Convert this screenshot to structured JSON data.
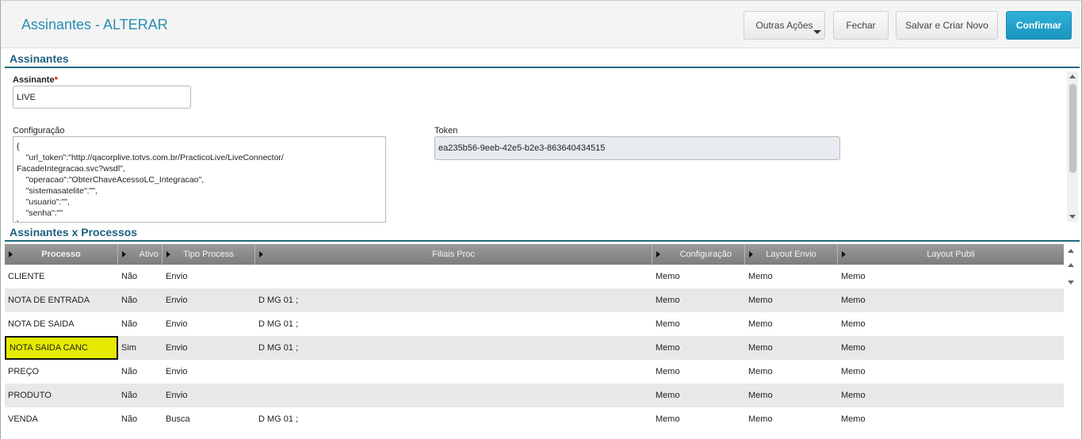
{
  "header": {
    "title": "Assinantes - ALTERAR",
    "buttons": {
      "outras": "Outras Ações",
      "fechar": "Fechar",
      "salvar": "Salvar e Criar Novo",
      "confirmar": "Confirmar"
    }
  },
  "form": {
    "section_title": "Assinantes",
    "assinante_label": "Assinante",
    "assinante_required": "*",
    "assinante_value": "LIVE",
    "config_label": "Configuração",
    "config_value": "{\n    \"url_token\":\"http://qacorplive.totvs.com.br/PracticoLive/LiveConnector/\nFacadeIntegracao.svc?wsdl\",\n    \"operacao\":\"ObterChaveAcessoLC_Integracao\",\n    \"sistemasatelite\":\"\",\n    \"usuario\":\"\",\n    \"senha\":\"\"\n}",
    "token_label": "Token",
    "token_value": "ea235b56-9eeb-42e5-b2e3-863640434515"
  },
  "processos": {
    "section_title": "Assinantes x Processos",
    "columns": [
      "Processo",
      "Ativo",
      "Tipo Process",
      "Filiais Proc",
      "Configuração",
      "Layout Envio",
      "Layout Publi"
    ],
    "rows": [
      [
        "CLIENTE",
        "Não",
        "Envio",
        "",
        "Memo",
        "Memo",
        "Memo"
      ],
      [
        "NOTA DE ENTRADA",
        "Não",
        "Envio",
        "D MG 01 ;",
        "Memo",
        "Memo",
        "Memo"
      ],
      [
        "NOTA DE SAIDA",
        "Não",
        "Envio",
        "D MG 01 ;",
        "Memo",
        "Memo",
        "Memo"
      ],
      [
        "NOTA SAIDA CANC",
        "Sim",
        "Envio",
        "D MG 01 ;",
        "Memo",
        "Memo",
        "Memo"
      ],
      [
        "PREÇO",
        "Não",
        "Envio",
        "",
        "Memo",
        "Memo",
        "Memo"
      ],
      [
        "PRODUTO",
        "Não",
        "Envio",
        "",
        "Memo",
        "Memo",
        "Memo"
      ],
      [
        "VENDA",
        "Não",
        "Busca",
        "D MG 01 ;",
        "Memo",
        "Memo",
        "Memo"
      ]
    ],
    "selected_row": 3
  },
  "colors": {
    "accent": "#2a8db4",
    "confirm_button": "#1a95bf",
    "selected_cell": "#e6ea00",
    "section_line": "#1e6a7e"
  }
}
